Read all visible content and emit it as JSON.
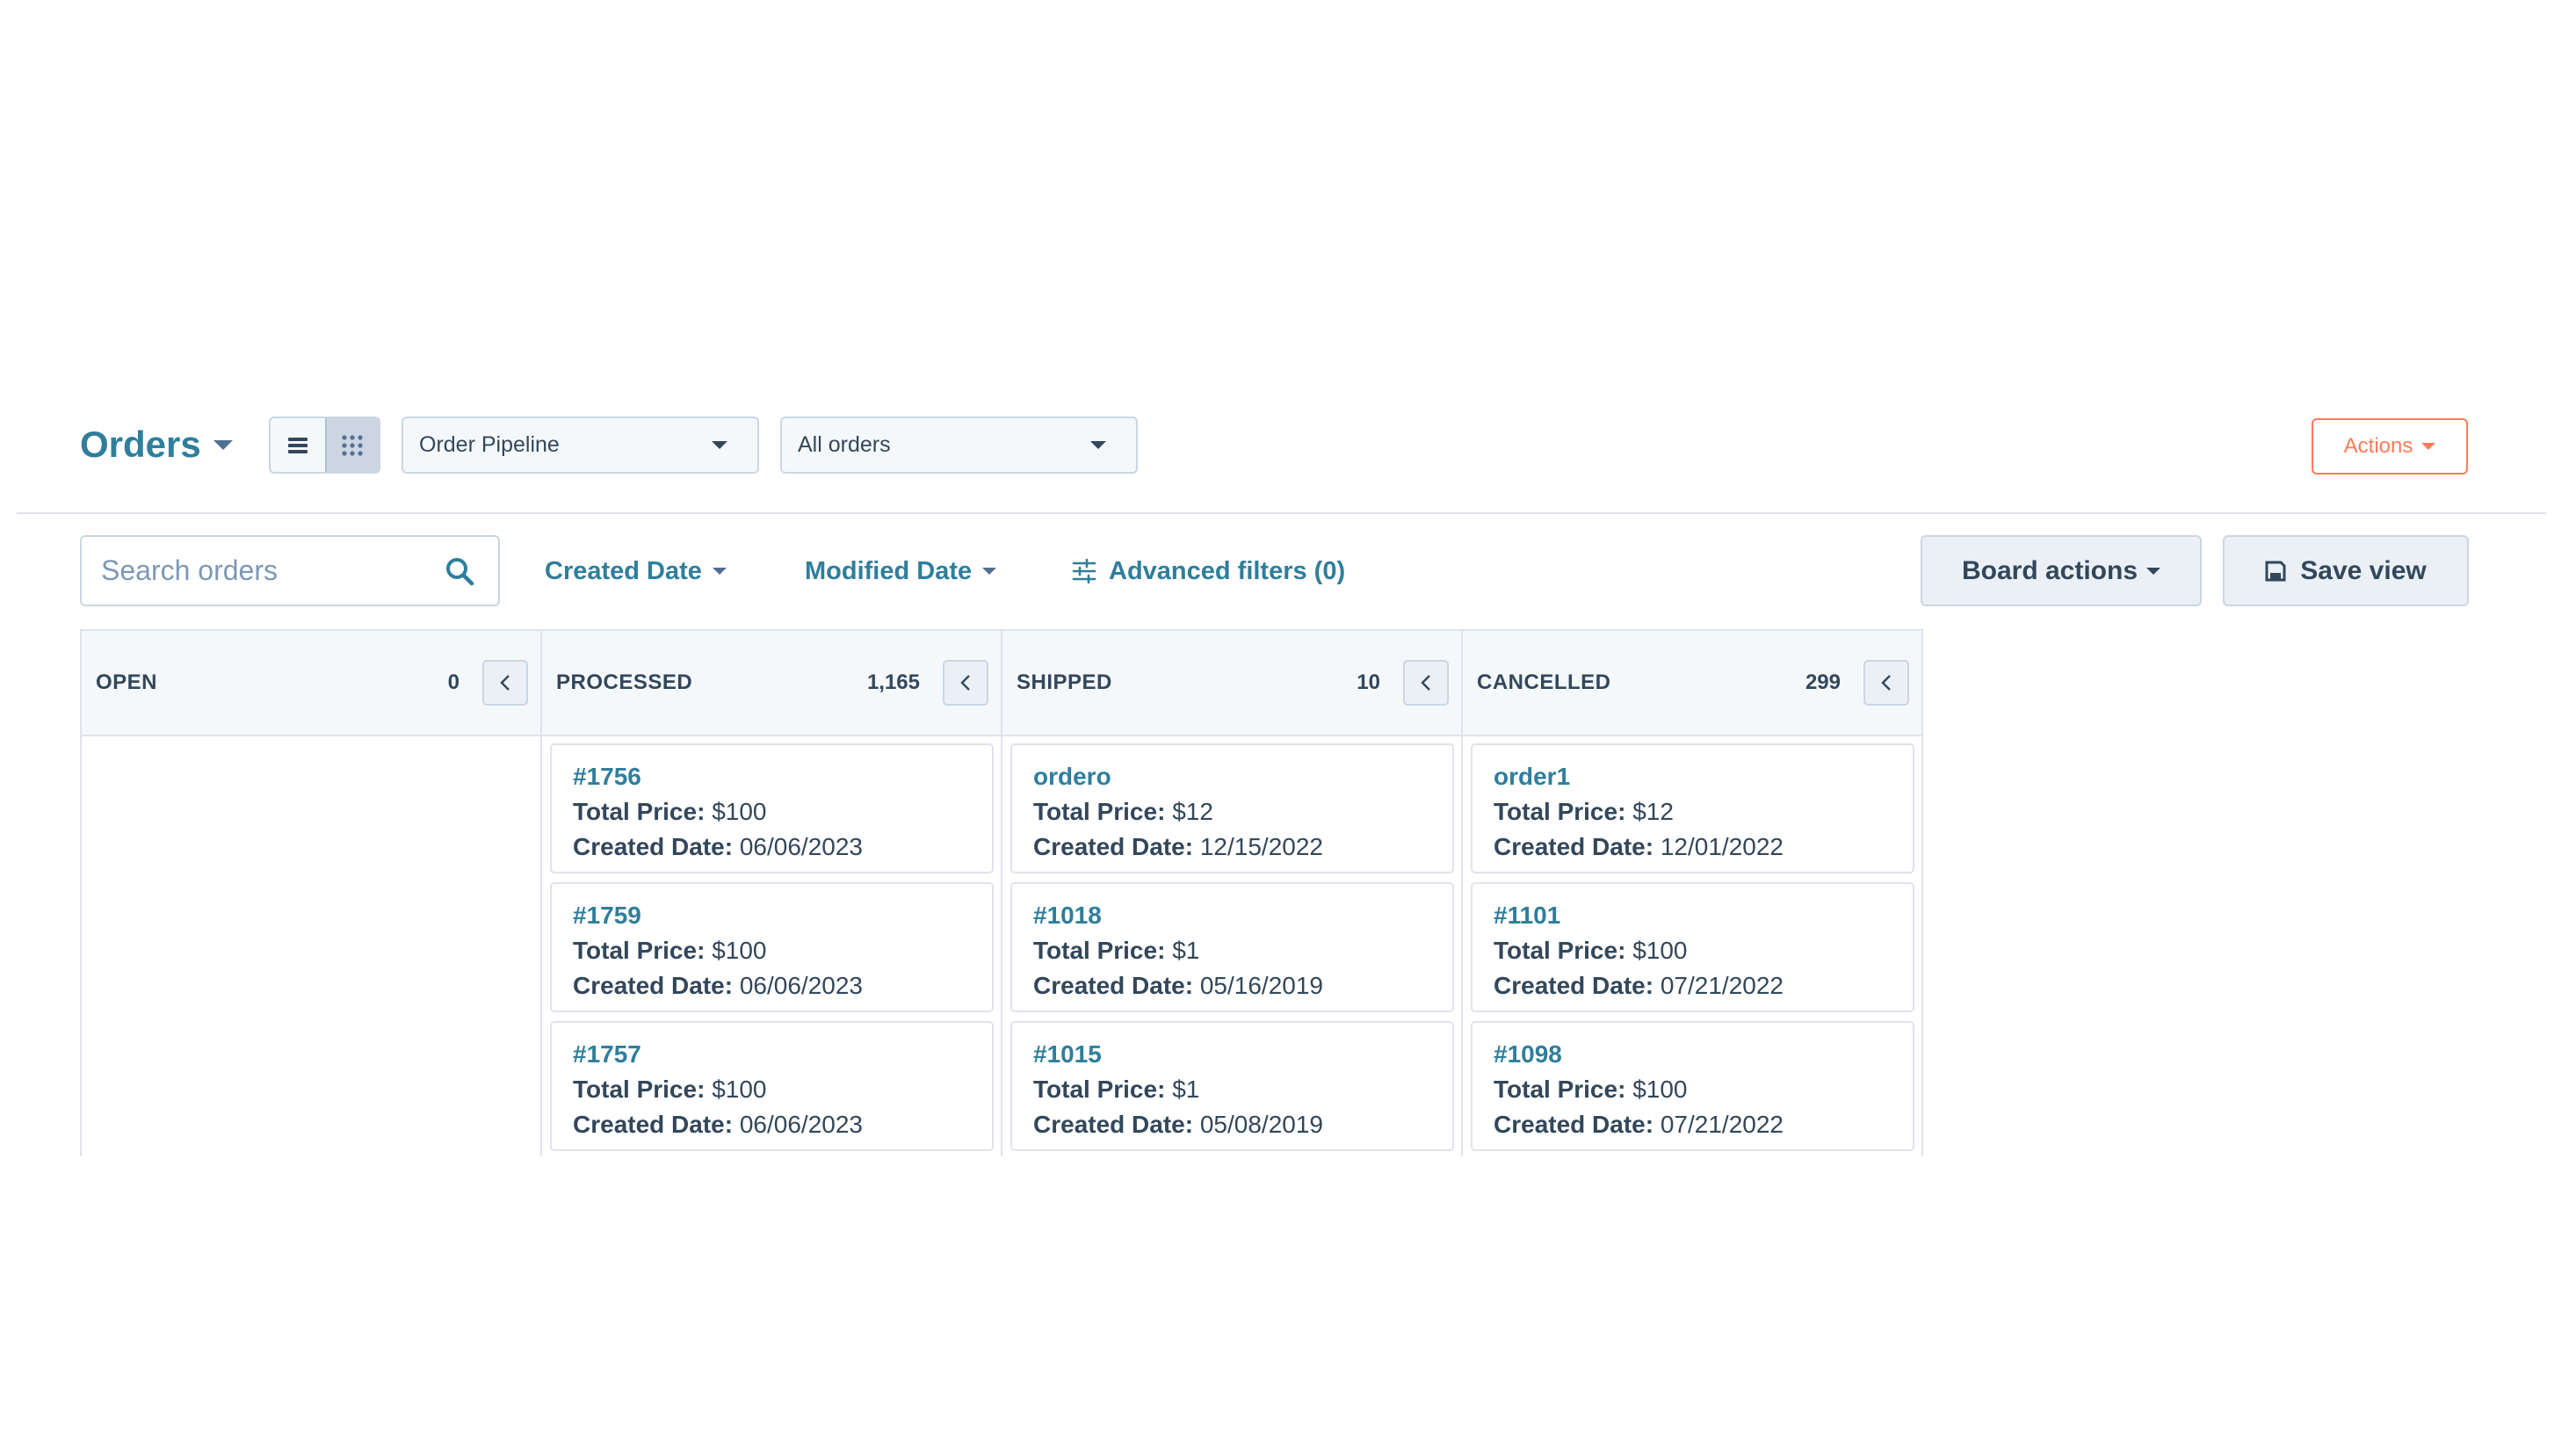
{
  "header": {
    "title": "Orders",
    "pipeline_select": "Order Pipeline",
    "view_select": "All orders",
    "actions_label": "Actions"
  },
  "toolbar": {
    "search_placeholder": "Search orders",
    "created_date_label": "Created Date",
    "modified_date_label": "Modified Date",
    "advanced_filters_label": "Advanced filters (0)",
    "board_actions_label": "Board actions",
    "save_view_label": "Save view"
  },
  "labels": {
    "total_price": "Total Price:",
    "created_date": "Created Date:"
  },
  "columns": [
    {
      "name": "OPEN",
      "count": "0",
      "cards": []
    },
    {
      "name": "PROCESSED",
      "count": "1,165",
      "cards": [
        {
          "id": "#1756",
          "price": "$100",
          "date": "06/06/2023"
        },
        {
          "id": "#1759",
          "price": "$100",
          "date": "06/06/2023"
        },
        {
          "id": "#1757",
          "price": "$100",
          "date": "06/06/2023"
        }
      ]
    },
    {
      "name": "SHIPPED",
      "count": "10",
      "cards": [
        {
          "id": "ordero",
          "price": "$12",
          "date": "12/15/2022"
        },
        {
          "id": "#1018",
          "price": "$1",
          "date": "05/16/2019"
        },
        {
          "id": "#1015",
          "price": "$1",
          "date": "05/08/2019"
        }
      ]
    },
    {
      "name": "CANCELLED",
      "count": "299",
      "cards": [
        {
          "id": "order1",
          "price": "$12",
          "date": "12/01/2022"
        },
        {
          "id": "#1101",
          "price": "$100",
          "date": "07/21/2022"
        },
        {
          "id": "#1098",
          "price": "$100",
          "date": "07/21/2022"
        }
      ]
    }
  ],
  "colors": {
    "brand_link": "#2f7e9b",
    "text": "#33475b",
    "accent_orange": "#ff7a59",
    "border": "#cbd6e2"
  },
  "icons": {
    "list_view": "list-view-icon",
    "board_view": "grid-view-icon",
    "search": "search-icon",
    "filters": "sliders-icon",
    "save": "floppy-disk-icon",
    "collapse": "chevron-left-icon"
  }
}
